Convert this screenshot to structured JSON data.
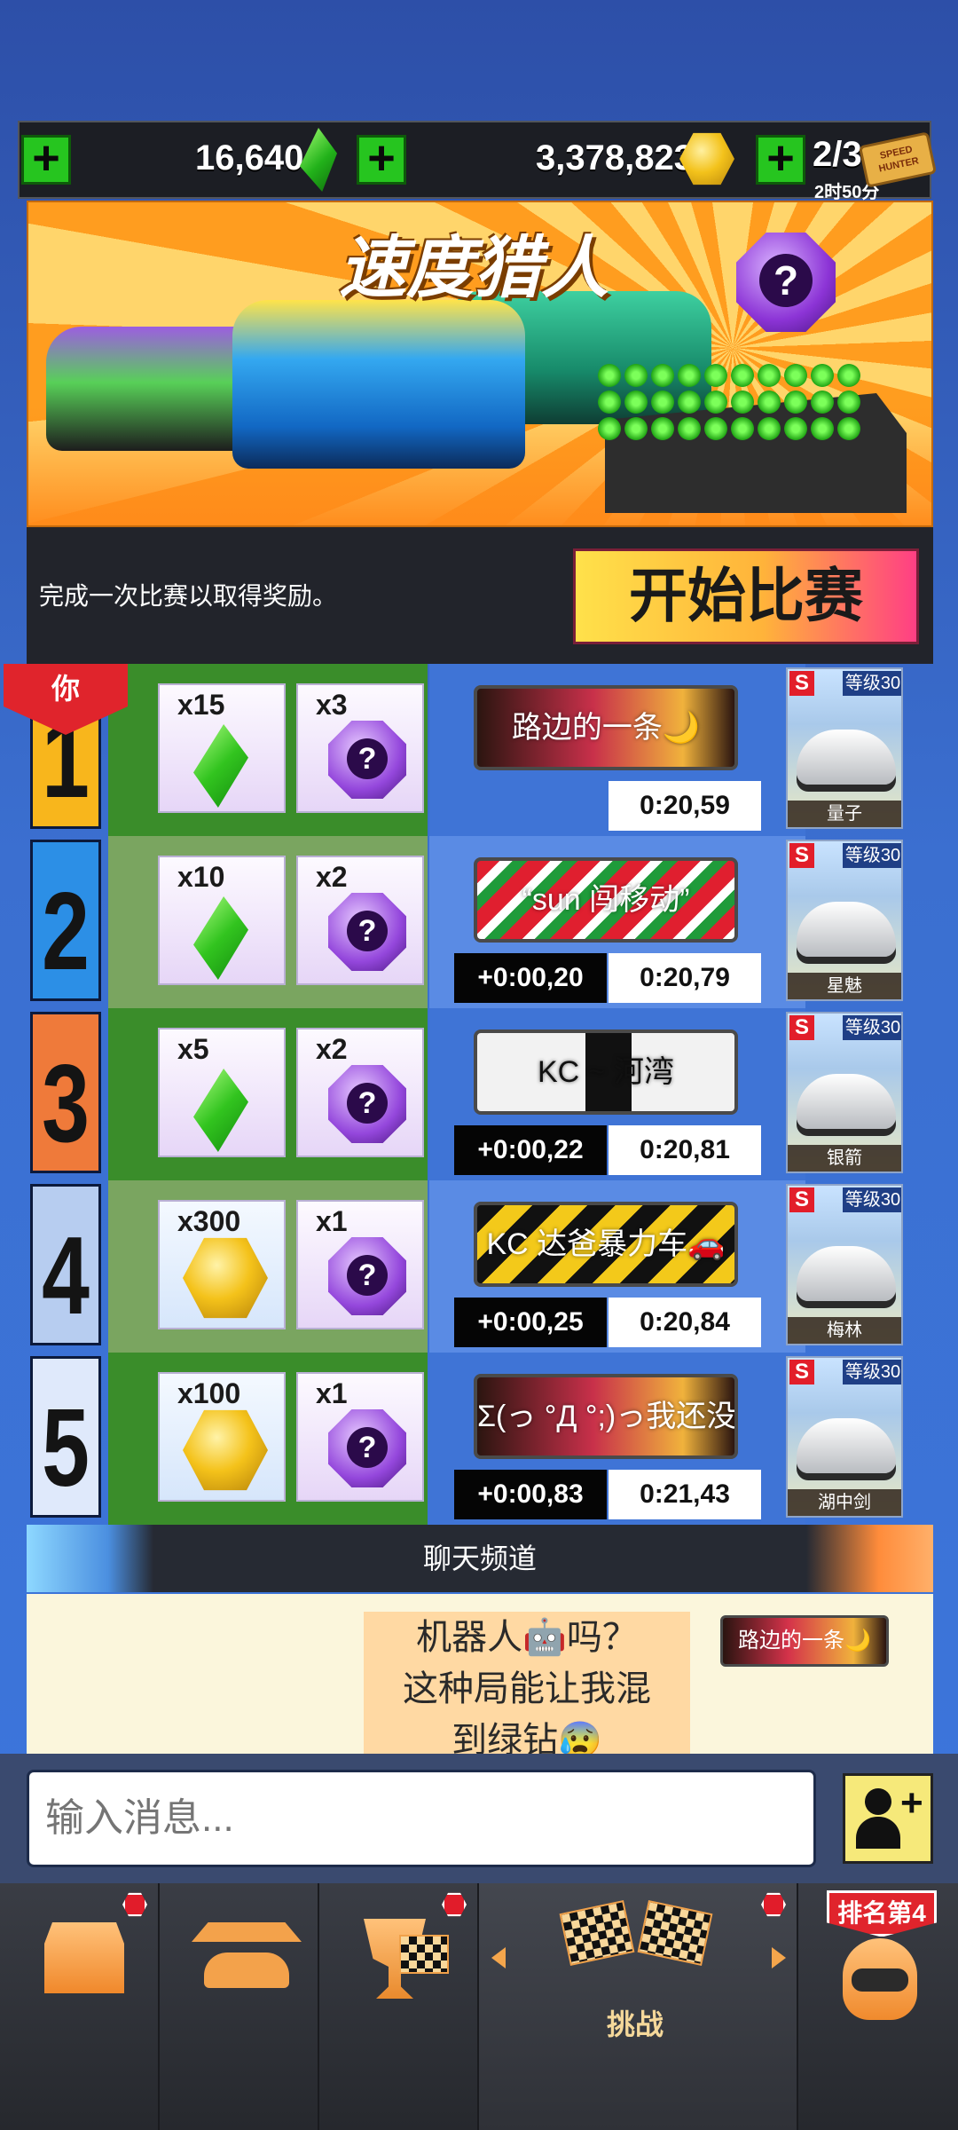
{
  "currency": {
    "gems": "16,640",
    "coins": "3,378,823",
    "tickets": "2/3",
    "ticket_timer": "2时50分",
    "ticket_logo": "SPEED HUNTER"
  },
  "event": {
    "title": "速度猎人",
    "description": "完成一次比赛以取得奖励。",
    "start_button": "开始比赛"
  },
  "you_tag": "你",
  "leaderboard": [
    {
      "rank": "1",
      "rank_color": "#f8b61c",
      "row_bg": "#3a8d2a",
      "reward1_type": "gem",
      "reward1_qty": "x15",
      "reward2_qty": "x3",
      "plate_text": "路边的一条🌙",
      "plate_bg": "linear-gradient(90deg,#2b1510,#c8304a 45%,#f0b23c 80%,#2b1510)",
      "plate_color": "#ffffff",
      "diff": "",
      "time": "0:20,59",
      "car_level": "等级30",
      "car_class": "S",
      "car_name": "量子",
      "area_bg": "#3f74d6"
    },
    {
      "rank": "2",
      "rank_color": "#2c8fe6",
      "row_bg": "#7aa560",
      "reward1_type": "gem",
      "reward1_qty": "x10",
      "reward2_qty": "x2",
      "plate_text": "“sun 闯移动”",
      "plate_bg": "repeating-linear-gradient(135deg,#e01f2f 0 18px,#ffffff 18px 28px,#1f9b3a 28px 40px)",
      "plate_color": "#ffffff",
      "diff": "+0:00,20",
      "time": "0:20,79",
      "car_level": "等级30",
      "car_class": "S",
      "car_name": "星魅",
      "area_bg": "#5a8be4"
    },
    {
      "rank": "3",
      "rank_color": "#ef7a3a",
      "row_bg": "#3a8d2a",
      "reward1_type": "gem",
      "reward1_qty": "x5",
      "reward2_qty": "x2",
      "plate_text": "KC ~ 河湾",
      "plate_bg": "linear-gradient(90deg,#f2f2f2 0 42%,#111 42% 60%,#f2f2f2 60% 100%)",
      "plate_color": "#111111",
      "diff": "+0:00,22",
      "time": "0:20,81",
      "car_level": "等级30",
      "car_class": "S",
      "car_name": "银箭",
      "area_bg": "#3f74d6"
    },
    {
      "rank": "4",
      "rank_color": "#b7cdf0",
      "row_bg": "#7aa560",
      "reward1_type": "coin",
      "reward1_qty": "x300",
      "reward2_qty": "x1",
      "plate_text": "KC 达爸暴力车🚗",
      "plate_bg": "repeating-linear-gradient(135deg,#111 0 22px,#f3c91a 22px 44px)",
      "plate_color": "#ffffff",
      "diff": "+0:00,25",
      "time": "0:20,84",
      "car_level": "等级30",
      "car_class": "S",
      "car_name": "梅林",
      "area_bg": "#5a8be4"
    },
    {
      "rank": "5",
      "rank_color": "#dfe9fb",
      "row_bg": "#3a8d2a",
      "reward1_type": "coin",
      "reward1_qty": "x100",
      "reward2_qty": "x1",
      "plate_text": "Σ(っ °Д °;)っ我还没上车",
      "plate_bg": "linear-gradient(90deg,#2b1510,#c8304a 45%,#f0b23c 80%,#2b1510)",
      "plate_color": "#ffffff",
      "diff": "+0:00,83",
      "time": "0:21,43",
      "car_level": "等级30",
      "car_class": "S",
      "car_name": "湖中剑",
      "area_bg": "#3f74d6"
    }
  ],
  "chat": {
    "header": "聊天频道",
    "message_line1": "机器人🤖吗？",
    "message_line2": "这种局能让我混",
    "message_line3": "到绿钻😰",
    "sender_plate": "路边的一条🌙"
  },
  "input": {
    "placeholder": "输入消息..."
  },
  "nav": {
    "challenge_label": "挑战",
    "rank_badge": "排名第4"
  }
}
